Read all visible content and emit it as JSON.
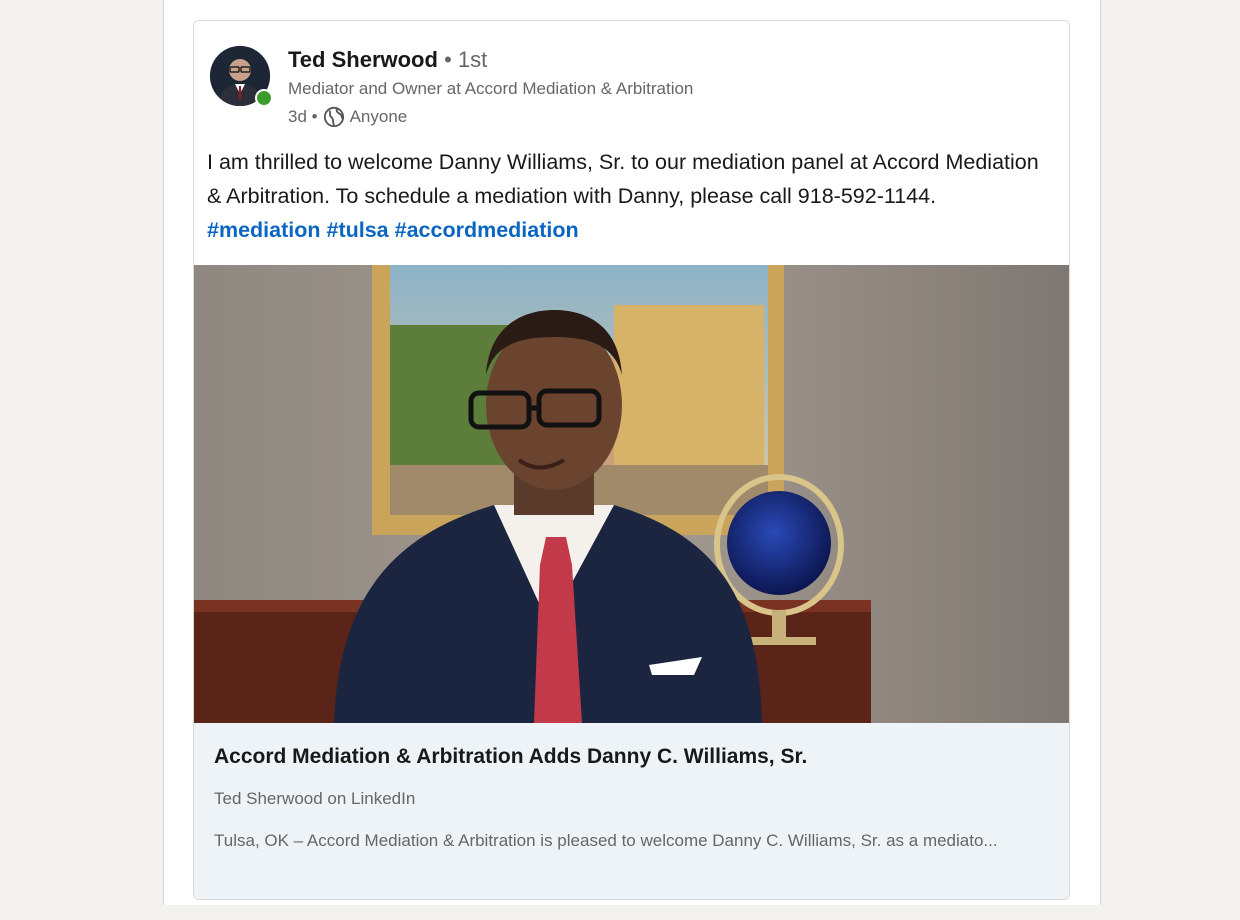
{
  "post": {
    "actor": {
      "name": "Ted Sherwood",
      "degree": "• 1st",
      "headline": "Mediator and Owner at Accord Mediation & Arbitration",
      "time": "3d •",
      "visibility": "Anyone",
      "avatar_icon": "profile-photo",
      "presence_color": "#3e9c2e"
    },
    "text": {
      "body": "I am thrilled to welcome Danny Williams, Sr.  to our mediation panel at Accord Mediation & Arbitration. To schedule a mediation with Danny, please call 918-592-1144.",
      "hashtags": [
        "#mediation",
        "#tulsa",
        "#accordmediation"
      ],
      "hashtag_color": "#0a66c2"
    },
    "image": {
      "description_icon": "portrait-photo"
    },
    "article": {
      "title": "Accord Mediation & Arbitration Adds Danny C. Williams, Sr.",
      "source": "Ted Sherwood on LinkedIn",
      "description": "Tulsa, OK – Accord Mediation & Arbitration is pleased to welcome Danny C. Williams, Sr. as a mediato..."
    }
  }
}
